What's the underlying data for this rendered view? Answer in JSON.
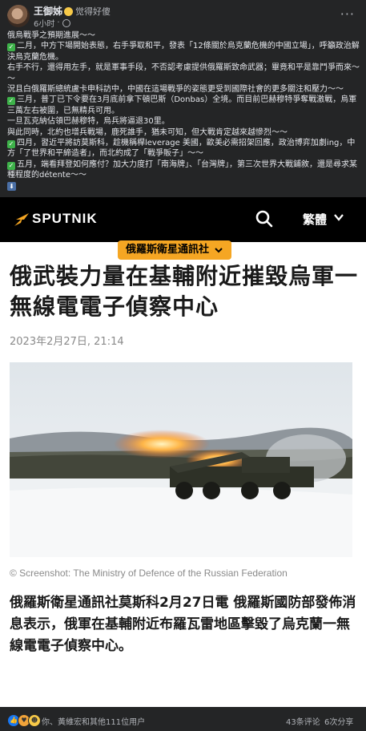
{
  "post": {
    "author": "王御姊",
    "feeling": "觉得好傻",
    "time": "6小时",
    "lines": [
      {
        "check": false,
        "text": "俄烏戰爭之預期進展～～"
      },
      {
        "check": true,
        "text": "二月，中方下場開始表態，右手爭取和平，發表「12條關於烏克蘭危機的中國立場」，呼籲政治解決烏克蘭危機。"
      },
      {
        "check": false,
        "text": "右手不行，還得用左手，就是軍事手段，不否認考慮提供俄羅斯致命武器；畢竟和平是靠鬥爭而來～～"
      },
      {
        "check": false,
        "text": "況且白俄羅斯總統盧卡申科訪中，中國在這場戰爭的姿態更受到國際社會的更多關注和壓力～～"
      },
      {
        "check": true,
        "text": "三月，普丁已下令要在3月底前拿下頓巴斯（Donbas）全境。而目前巴赫穆特爭奪戰激戰，烏軍三萬左右被圍，已無精兵可用。"
      },
      {
        "check": false,
        "text": "一旦瓦克納佔領巴赫穆特，烏兵將逼退30里。"
      },
      {
        "check": false,
        "text": "與此同時，北約也增兵戰場，鹿死誰手，猶未可知，但大戰肯定越來越慘烈～～"
      },
      {
        "check": true,
        "text": "四月，習近平將訪莫斯科，趁機稱桿leverage 美國，歐美必需招架回應，政治博弈加劇ing，中方「了世界和平締造者」，而北約成了「戰爭販子」～～"
      },
      {
        "check": true,
        "text": "五月，端看拜登如何應付？加大力度打「南海牌」、「台灣牌」，第三次世界大戰鋪敘，還是尋求某種程度的détente～～"
      }
    ]
  },
  "article": {
    "brand": "SPUTNIK",
    "language": "繁體",
    "section": "俄羅斯衛星通訊社",
    "title": "俄武裝力量在基輔附近摧毀烏軍一無線電電子偵察中心",
    "date": "2023年2月27日, 21:14",
    "caption": "© Screenshot: The Ministry of Defence of the Russian Federation",
    "lead": "俄羅斯衛星通訊社莫斯科2月27日電 俄羅斯國防部發佈消息表示，俄軍在基輔附近布羅瓦雷地區擊毀了烏克蘭一無線電電子偵察中心。",
    "brand_color": "#f5a623"
  },
  "footer": {
    "reactions_text": "你、黃維宏和其他111位用户",
    "comments": "43条评论",
    "shares": "6次分享"
  }
}
